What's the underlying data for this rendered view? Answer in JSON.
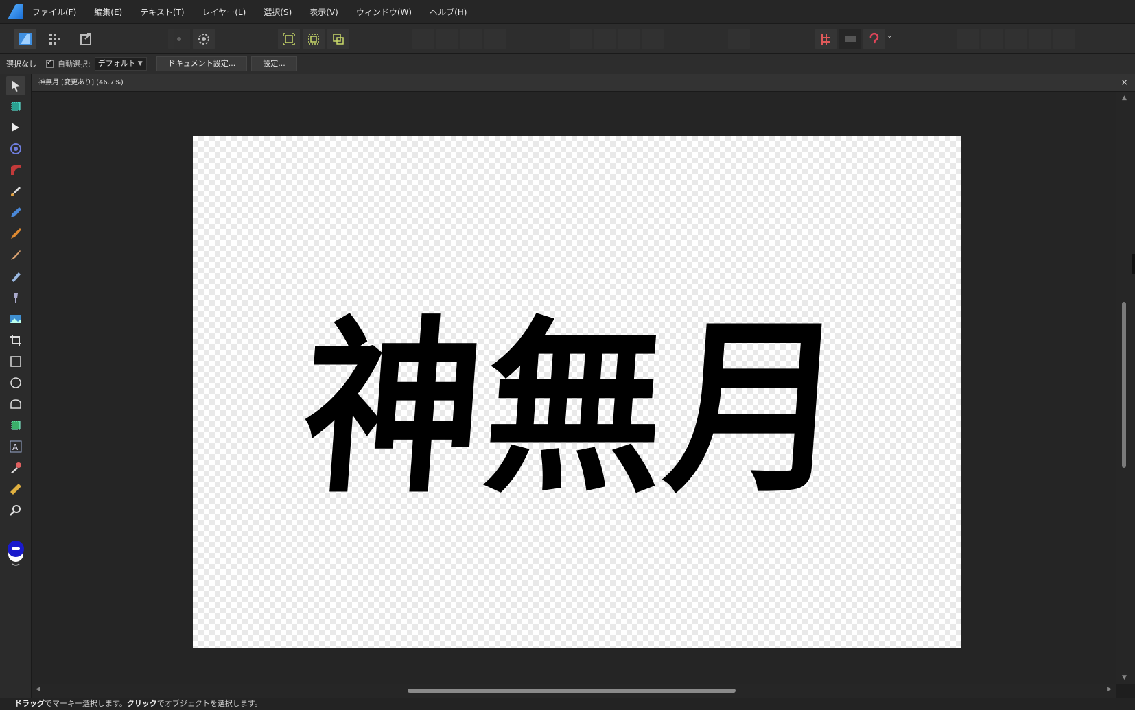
{
  "menubar": {
    "items": [
      "ファイル(F)",
      "編集(E)",
      "テキスト(T)",
      "レイヤー(L)",
      "選択(S)",
      "表示(V)",
      "ウィンドウ(W)",
      "ヘルプ(H)"
    ]
  },
  "toolbar": {
    "persona_icons": [
      "designer-persona-icon",
      "pixel-persona-icon",
      "export-persona-icon"
    ],
    "action_icons": [
      "settings-icon",
      "gear-icon",
      "snap-select-icon",
      "snap-bounds-icon",
      "snap-geometry-icon",
      "transform-icon",
      "arrange-icon",
      "align-icon",
      "boolean-icon",
      "snapping-icon",
      "help-icon"
    ]
  },
  "context": {
    "selection_label": "選択なし",
    "auto_select_label": "自動選択:",
    "auto_select_value": "デフォルト",
    "document_settings": "ドキュメント設定...",
    "settings": "設定..."
  },
  "document": {
    "tab_title": "神無月 [変更あり] (46.7%)",
    "close_label": "×",
    "artwork_text": "神無月"
  },
  "tools": [
    "move-tool-icon",
    "artboard-tool-icon",
    "node-tool-icon",
    "corner-tool-icon",
    "point-transform-icon",
    "pen-tool-icon",
    "pencil-tool-icon",
    "vector-brush-icon",
    "paint-brush-icon",
    "fill-tool-icon",
    "transparency-tool-icon",
    "place-image-icon",
    "crop-tool-icon",
    "rectangle-tool-icon",
    "ellipse-tool-icon",
    "rounded-shape-icon",
    "shape-tool-icon",
    "text-tool-icon",
    "color-picker-icon",
    "measure-tool-icon",
    "zoom-tool-icon"
  ],
  "colors": {
    "fill": "#1a1acc",
    "stroke": "#ffffff"
  },
  "status": {
    "drag": "ドラッグ",
    "drag_rest": "でマーキー選択します。",
    "click": "クリック",
    "click_rest": "でオブジェクトを選択します。"
  }
}
